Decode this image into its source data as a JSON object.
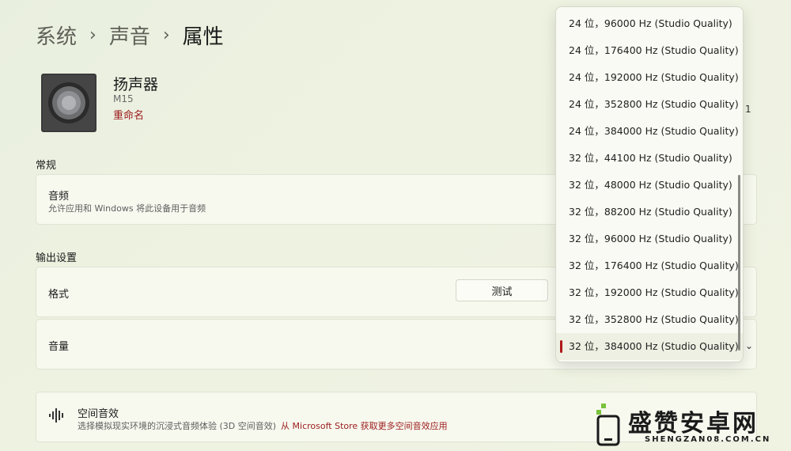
{
  "breadcrumb": [
    "系统",
    "声音",
    "属性"
  ],
  "device": {
    "name": "扬声器",
    "model": "M15",
    "rename": "重命名"
  },
  "sections": {
    "general": "常规",
    "output": "输出设置"
  },
  "audio_card": {
    "title": "音频",
    "subtitle": "允许应用和 Windows 将此设备用于音频"
  },
  "format_card": {
    "title": "格式",
    "test_button": "测试"
  },
  "volume_card": {
    "title": "音量"
  },
  "spatial_card": {
    "title": "空间音效",
    "subtitle": "选择模拟现实环境的沉浸式音频体验 (3D 空间音效)",
    "store_link": "从 Microsoft Store 获取更多空间音效应用"
  },
  "format_options": [
    "24 位，96000 Hz (Studio Quality)",
    "24 位，176400 Hz (Studio Quality)",
    "24 位，192000 Hz (Studio Quality)",
    "24 位，352800 Hz (Studio Quality)",
    "24 位，384000 Hz (Studio Quality)",
    "32 位，44100 Hz (Studio Quality)",
    "32 位，48000 Hz (Studio Quality)",
    "32 位，88200 Hz (Studio Quality)",
    "32 位，96000 Hz (Studio Quality)",
    "32 位，176400 Hz (Studio Quality)",
    "32 位，192000 Hz (Studio Quality)",
    "32 位，352800 Hz (Studio Quality)",
    "32 位，384000 Hz (Studio Quality)"
  ],
  "selected_format": "32 位，384000 Hz (Studio Quality)",
  "watermark": {
    "text": "盛赞安卓网",
    "domain": "SHENGZAN08.COM.CN"
  },
  "colors": {
    "accent": "#b01818",
    "link": "#9b1b1b",
    "card_bg": "#f7f9ef"
  }
}
